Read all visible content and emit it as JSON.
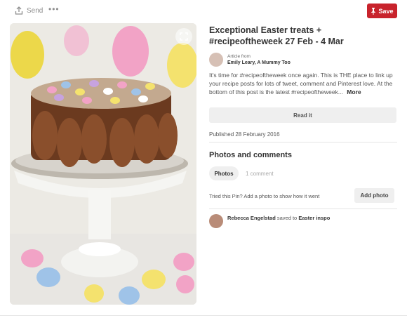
{
  "topbar": {
    "send_label": "Send",
    "more_label": "•••",
    "save_label": "Save"
  },
  "pin": {
    "title": "Exceptional Easter treats + #recipeoftheweek 27 Feb - 4 Mar",
    "source_prefix": "Article from",
    "source_name": "Emily Leary, A Mummy Too",
    "description": "It's time for #recipeoftheweek once again. This is THE place to link up your recipe posts for lots of tweet, comment and Pinterest love. At the bottom of this post is the latest #recipeoftheweek...",
    "more_label": "More",
    "read_it_label": "Read it",
    "published": "Published 28 February 2016"
  },
  "photos": {
    "heading": "Photos and comments",
    "tab_photos": "Photos",
    "tab_comment": "1 comment",
    "tried_text": "Tried this Pin? Add a photo to show how it went",
    "add_photo_label": "Add photo"
  },
  "activity": {
    "user": "Rebecca Engelstad",
    "action": "saved to",
    "board": "Easter inspo"
  },
  "colors": {
    "brand_red": "#c8232c"
  }
}
